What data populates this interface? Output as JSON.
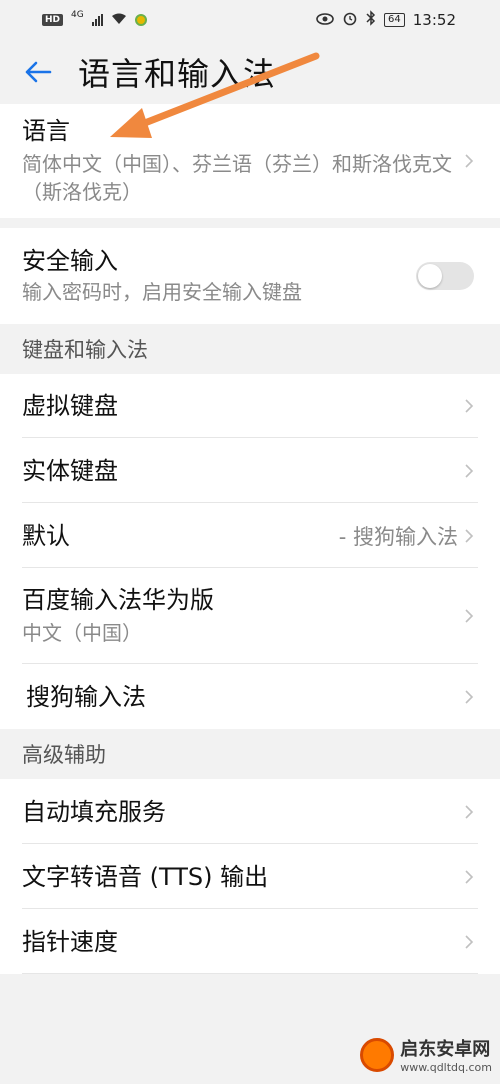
{
  "status_bar": {
    "left_badge": "HD",
    "network": "4G",
    "right_batt": "64",
    "time": "13:52"
  },
  "header": {
    "title": "语言和输入法"
  },
  "language": {
    "title": "语言",
    "subtitle": "简体中文（中国）、芬兰语（芬兰）和斯洛伐克文（斯洛伐克）"
  },
  "secure_input": {
    "title": "安全输入",
    "subtitle": "输入密码时，启用安全输入键盘",
    "enabled": false
  },
  "keyboard_section": {
    "header": "键盘和输入法",
    "items": [
      {
        "title": "虚拟键盘"
      },
      {
        "title": "实体键盘"
      },
      {
        "title": "默认",
        "value": "- 搜狗输入法"
      },
      {
        "title": "百度输入法华为版",
        "subtitle": "中文（中国）"
      },
      {
        "title": "搜狗输入法"
      }
    ]
  },
  "advanced_section": {
    "header": "高级辅助",
    "items": [
      {
        "title": "自动填充服务"
      },
      {
        "title": "文字转语音 (TTS) 输出"
      },
      {
        "title": "指针速度"
      }
    ]
  },
  "watermark": {
    "name": "启东安卓网",
    "url": "www.qdltdq.com"
  },
  "colors": {
    "accent": "#1a73e8",
    "annotation_arrow": "#f0883e"
  }
}
